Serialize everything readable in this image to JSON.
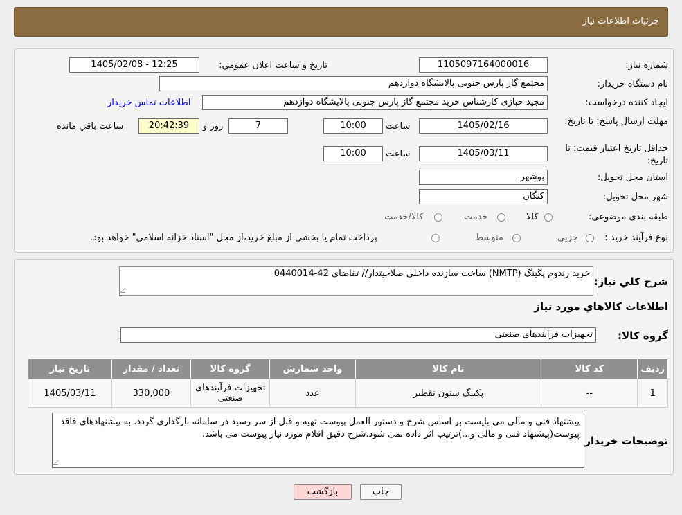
{
  "header": {
    "title": "جزئیات اطلاعات نیاز"
  },
  "form": {
    "need_number_label": "شماره نیاز:",
    "need_number": "1105097164000016",
    "announce_label": "تاريخ و ساعت اعلان عمومي:",
    "announce_value": "1405/02/08 - 12:25",
    "buyer_org_label": "نام دستگاه خريدار:",
    "buyer_org": "مجتمع گاز پارس جنوبی  پالایشگاه دوازدهم",
    "creator_label": "ايجاد کننده درخواست:",
    "creator": "مجید خبازی کارشناس خرید مجتمع گاز پارس جنوبی  پالایشگاه دوازدهم",
    "contact_link": "اطلاعات تماس خريدار",
    "deadline_label": "مهلت ارسال پاسخ: تا تاريخ:",
    "deadline_date": "1405/02/16",
    "time_label": "ساعت",
    "deadline_time": "10:00",
    "days": "7",
    "days_label": "روز و",
    "remaining_time": "20:42:39",
    "remaining_label": "ساعت باقي مانده",
    "validity_label": "حداقل تاريخ اعتبار قيمت: تا تاريخ:",
    "validity_date": "1405/03/11",
    "validity_time_label": "ساعت",
    "validity_time": "10:00",
    "province_label": "استان محل تحويل:",
    "province": "بوشهر",
    "city_label": "شهر محل تحويل:",
    "city": "کنگان",
    "category_label": "طبقه بندی موضوعی:",
    "category_options": [
      "کالا",
      "خدمت",
      "کالا/خدمت"
    ],
    "process_label": "نوع فرآيند خريد :",
    "process_options": [
      "جزيي",
      "متوسط"
    ],
    "process_note": "پرداخت تمام یا بخشی از مبلغ خرید،از محل \"اسناد خزانه اسلامی\" خواهد بود."
  },
  "details": {
    "description_label": "شرح کلي نياز:",
    "description": "خرید رندوم پگینگ (NMTP) ساخت سازنده داخلی صلاحیتدار// تقاضای 42-0440014",
    "goods_info_title": "اطلاعات کالاهاي مورد نياز",
    "goods_group_label": "گروه کالا:",
    "goods_group": "تجهیزات فرآیندهای صنعتی",
    "table": {
      "headers": [
        "رديف",
        "کد کالا",
        "نام کالا",
        "واحد شمارش",
        "گروه کالا",
        "تعداد / مقدار",
        "تاريخ نياز"
      ],
      "rows": [
        [
          "1",
          "--",
          "پکینگ ستون تقطیر",
          "عدد",
          "تجهیزات فرآیندهای صنعتی",
          "330,000",
          "1405/03/11"
        ]
      ]
    },
    "buyer_notes_label": "توضيحات خريدار:",
    "buyer_notes": "پیشنهاد فنی و مالی می بایست بر اساس شرح و دستور العمل پیوست تهیه و قبل از سر رسید در سامانه بارگذاری گردد. به پیشنهادهای فاقد پیوست(پیشنهاد فنی و مالی و...)ترتیب اثر داده نمی شود.شرح دقیق اقلام مورد نیاز پیوست می باشد."
  },
  "buttons": {
    "print": "چاپ",
    "back": "بازگشت"
  },
  "colors": {
    "header": "#8b6b40",
    "back_button": "#ffd6d6",
    "print_button": "#f8f8f8",
    "table_header": "#909090"
  }
}
